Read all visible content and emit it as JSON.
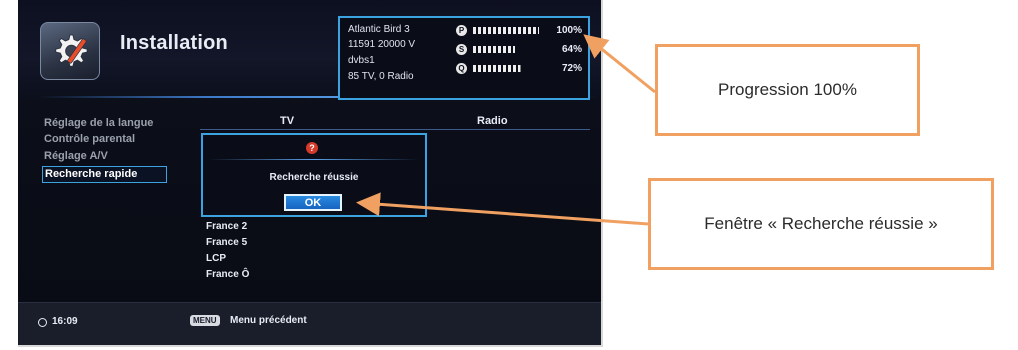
{
  "window": {
    "title": "Installation"
  },
  "info_box": {
    "satellite": "Atlantic Bird 3",
    "frequency": "11591 20000 V",
    "system": "dvbs1",
    "found": "85 TV, 0 Radio",
    "meters": [
      {
        "badge": "P",
        "label": "100%",
        "value": 100
      },
      {
        "badge": "S",
        "label": "64%",
        "value": 64
      },
      {
        "badge": "Q",
        "label": "72%",
        "value": 72
      }
    ]
  },
  "menu": {
    "items": [
      {
        "label": "Réglage de la langue"
      },
      {
        "label": "Contrôle parental"
      },
      {
        "label": "Réglage A/V"
      },
      {
        "label": "Recherche rapide",
        "active": true
      }
    ]
  },
  "columns": {
    "tv": "TV",
    "radio": "Radio"
  },
  "channels": [
    "France 2",
    "France 5",
    "LCP",
    "France Ô"
  ],
  "dialog": {
    "icon": "?",
    "message": "Recherche réussie",
    "ok_label": "OK"
  },
  "footer": {
    "time": "16:09",
    "menu_key": "MENU",
    "menu_label": "Menu précédent"
  },
  "callouts": {
    "progress": "Progression 100%",
    "dialog": "Fenêtre « Recherche réussie »"
  },
  "colors": {
    "accent": "#3aa3e0",
    "callout_border": "#f0a060",
    "ok_button": "#1e78d4"
  }
}
